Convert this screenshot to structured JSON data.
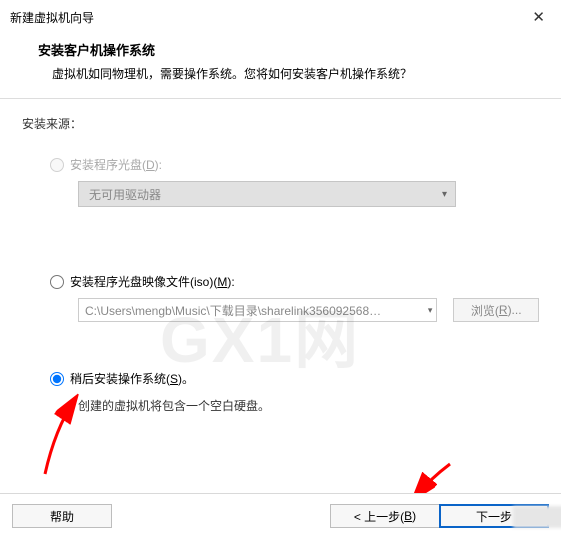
{
  "window": {
    "title": "新建虚拟机向导"
  },
  "header": {
    "title": "安装客户机操作系统",
    "subtitle": "虚拟机如同物理机，需要操作系统。您将如何安装客户机操作系统？"
  },
  "source_label": "安装来源：",
  "option_drive": {
    "label_prefix": "安装程序光盘(",
    "hotkey": "D",
    "label_suffix": "):",
    "dropdown": "无可用驱动器"
  },
  "option_iso": {
    "label_prefix": "安装程序光盘映像文件(iso)(",
    "hotkey": "M",
    "label_suffix": "):",
    "path": "C:\\Users\\mengb\\Music\\下载目录\\sharelink356092568…",
    "browse_prefix": "浏览(",
    "browse_hotkey": "R",
    "browse_suffix": ")..."
  },
  "option_later": {
    "label_prefix": "稍后安装操作系统(",
    "hotkey": "S",
    "label_suffix": ")。",
    "note": "创建的虚拟机将包含一个空白硬盘。"
  },
  "buttons": {
    "help": "帮助",
    "back_prefix": "< 上一步(",
    "back_hotkey": "B",
    "back_suffix": ")",
    "next": "下一步"
  },
  "watermark": "GX1网"
}
